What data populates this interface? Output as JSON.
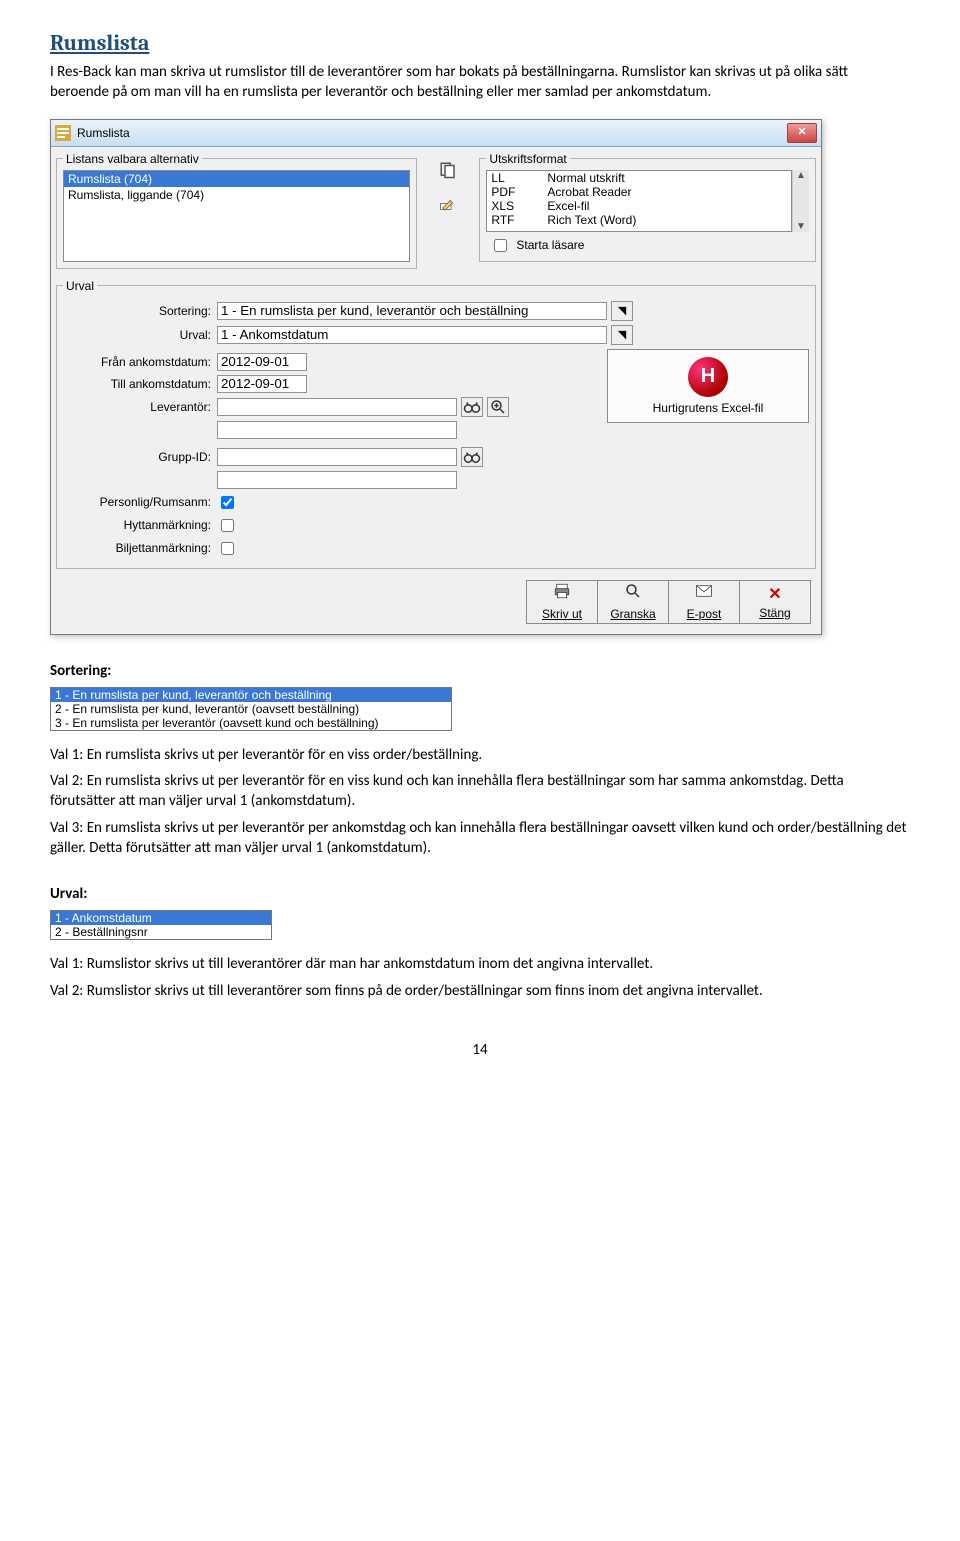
{
  "heading": "Rumslista",
  "intro1": "I Res-Back kan man skriva ut rumslistor till de leverantörer som har bokats på beställningarna. Rumslistor kan skrivas ut på olika sätt beroende på om man vill ha en rumslista per leverantör och beställning eller mer samlad per ankomstdatum.",
  "dialog": {
    "title": "Rumslista",
    "listans_legend": "Listans valbara alternativ",
    "utskrift_legend": "Utskriftsformat",
    "urval_legend": "Urval",
    "list_items": [
      "Rumslista (704)",
      "Rumslista, liggande (704)"
    ],
    "list_selected": 0,
    "formats": [
      {
        "code": "LL",
        "desc": "Normal utskrift"
      },
      {
        "code": "PDF",
        "desc": "Acrobat Reader"
      },
      {
        "code": "XLS",
        "desc": "Excel-fil"
      },
      {
        "code": "RTF",
        "desc": "Rich Text (Word)"
      }
    ],
    "starta_lasare": "Starta läsare",
    "fields": {
      "sortering_label": "Sortering:",
      "sortering_value": "1 - En rumslista per kund, leverantör och beställning",
      "urval_label": "Urval:",
      "urval_value": "1 - Ankomstdatum",
      "fran_label": "Från ankomstdatum:",
      "fran_value": "2012-09-01",
      "till_label": "Till ankomstdatum:",
      "till_value": "2012-09-01",
      "lev_label": "Leverantör:",
      "lev_value": "",
      "grupp_label": "Grupp-ID:",
      "grupp_value": "",
      "personlig_label": "Personlig/Rumsanm:",
      "hytt_label": "Hyttanmärkning:",
      "biljett_label": "Biljettanmärkning:"
    },
    "excel_button": "Hurtigrutens Excel-fil",
    "toolbar": {
      "skriv": "Skriv ut",
      "granska": "Granska",
      "epost": "E-post",
      "stang": "Stäng"
    }
  },
  "sort_header": "Sortering:",
  "sort_list": [
    "1 - En rumslista per kund, leverantör och beställning",
    "2 - En rumslista per kund, leverantör (oavsett beställning)",
    "3 - En rumslista per leverantör (oavsett kund och beställning)"
  ],
  "sort_selected": 0,
  "p_val1": "Val 1: En rumslista skrivs ut per leverantör för en viss order/beställning.",
  "p_val2": "Val 2: En rumslista skrivs ut per leverantör för en viss kund och kan innehålla flera beställningar som har samma ankomstdag. Detta förutsätter att man väljer urval 1 (ankomstdatum).",
  "p_val3": "Val 3: En rumslista skrivs ut per leverantör per ankomstdag och kan innehålla flera beställningar oavsett vilken kund och order/beställning det gäller. Detta förutsätter att man väljer urval 1 (ankomstdatum).",
  "urval_header": "Urval:",
  "urval_list": [
    "1 - Ankomstdatum",
    "2 - Beställningsnr"
  ],
  "urval_selected": 0,
  "p_urval1": "Val 1: Rumslistor skrivs ut till leverantörer där man har ankomstdatum inom det angivna intervallet.",
  "p_urval2": "Val 2: Rumslistor skrivs ut till leverantörer som finns på de order/beställningar som finns inom det angivna intervallet.",
  "page_number": "14"
}
